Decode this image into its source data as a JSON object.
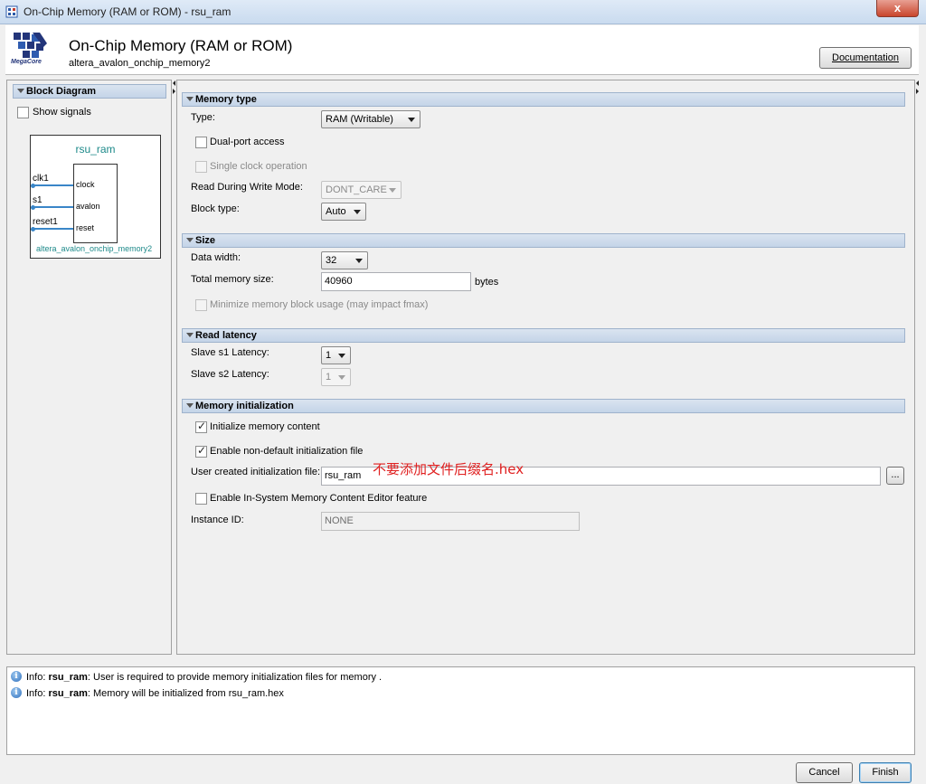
{
  "window": {
    "title": "On-Chip Memory (RAM or ROM) - rsu_ram",
    "close_label": "x"
  },
  "header": {
    "logo_text": "MegaCore",
    "title": "On-Chip Memory (RAM or ROM)",
    "subtitle": "altera_avalon_onchip_memory2",
    "documentation_label": "Documentation"
  },
  "left": {
    "section_title": "Block Diagram",
    "show_signals_label": "Show signals",
    "block": {
      "instance_name": "rsu_ram",
      "module_name": "altera_avalon_onchip_memory2",
      "ports": [
        {
          "external": "clk1",
          "internal": "clock"
        },
        {
          "external": "s1",
          "internal": "avalon"
        },
        {
          "external": "reset1",
          "internal": "reset"
        }
      ]
    }
  },
  "memory_type": {
    "section_title": "Memory type",
    "type_label": "Type:",
    "type_value": "RAM (Writable)",
    "dual_port_label": "Dual-port access",
    "single_clock_label": "Single clock operation",
    "rdw_label": "Read During Write Mode:",
    "rdw_value": "DONT_CARE",
    "block_type_label": "Block type:",
    "block_type_value": "Auto"
  },
  "size": {
    "section_title": "Size",
    "data_width_label": "Data width:",
    "data_width_value": "32",
    "total_size_label": "Total memory size:",
    "total_size_value": "40960",
    "total_size_unit": "bytes",
    "minimize_label": "Minimize memory block usage (may impact fmax)"
  },
  "read_latency": {
    "section_title": "Read latency",
    "s1_label": "Slave s1 Latency:",
    "s1_value": "1",
    "s2_label": "Slave s2 Latency:",
    "s2_value": "1"
  },
  "memory_init": {
    "section_title": "Memory initialization",
    "init_content_label": "Initialize memory content",
    "non_default_label": "Enable non-default initialization file",
    "user_file_label": "User created initialization file:",
    "user_file_value": "rsu_ram",
    "annotation": "不要添加文件后缀名.hex",
    "browse_label": "...",
    "in_system_label": "Enable In-System Memory Content Editor feature",
    "instance_id_label": "Instance ID:",
    "instance_id_value": "NONE"
  },
  "messages": [
    {
      "prefix": "Info: ",
      "bold": "rsu_ram",
      "text": ": User is required to provide memory initialization files for memory ."
    },
    {
      "prefix": "Info: ",
      "bold": "rsu_ram",
      "text": ": Memory will be initialized from rsu_ram.hex"
    }
  ],
  "footer": {
    "cancel_label": "Cancel",
    "finish_label": "Finish"
  },
  "colors": {
    "section_header": "#c4d4e8",
    "accent_teal": "#1e8a8a",
    "port_line": "#3a86c8",
    "annotation_red": "#e02020"
  }
}
